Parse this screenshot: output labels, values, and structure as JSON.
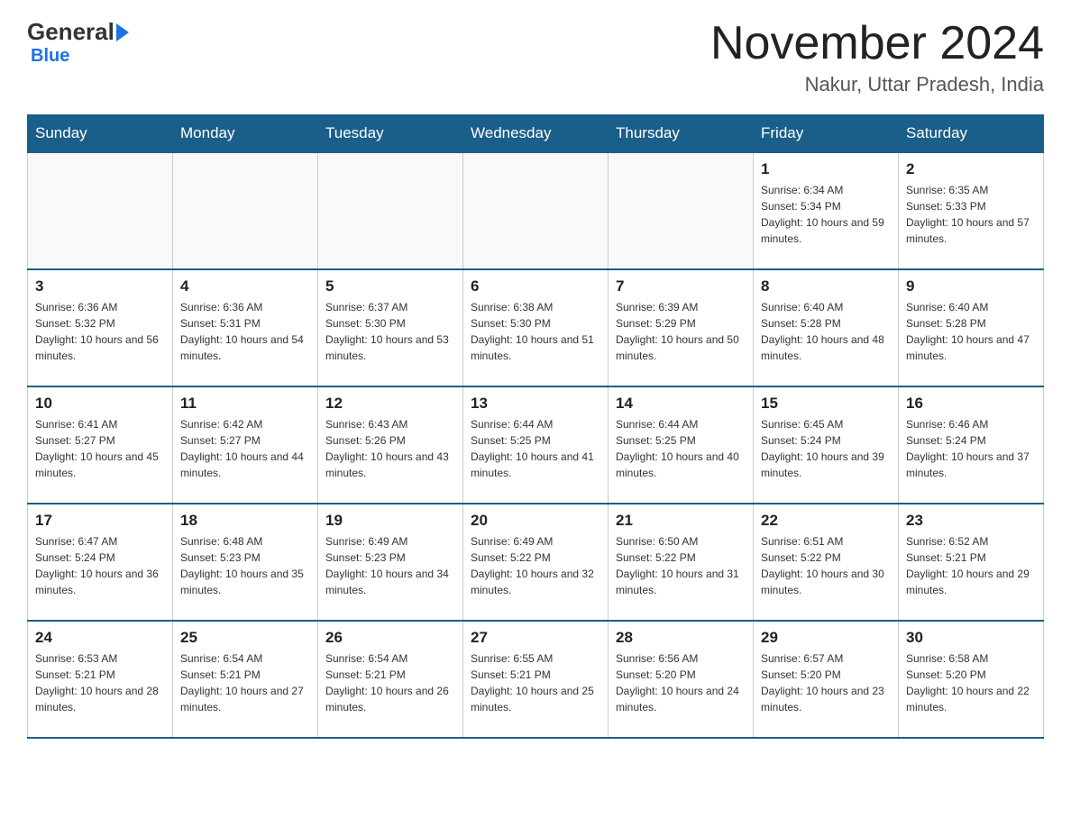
{
  "header": {
    "logo": {
      "general": "General",
      "blue": "Blue"
    },
    "title": "November 2024",
    "location": "Nakur, Uttar Pradesh, India"
  },
  "weekdays": [
    "Sunday",
    "Monday",
    "Tuesday",
    "Wednesday",
    "Thursday",
    "Friday",
    "Saturday"
  ],
  "weeks": [
    [
      {
        "day": "",
        "info": ""
      },
      {
        "day": "",
        "info": ""
      },
      {
        "day": "",
        "info": ""
      },
      {
        "day": "",
        "info": ""
      },
      {
        "day": "",
        "info": ""
      },
      {
        "day": "1",
        "info": "Sunrise: 6:34 AM\nSunset: 5:34 PM\nDaylight: 10 hours and 59 minutes."
      },
      {
        "day": "2",
        "info": "Sunrise: 6:35 AM\nSunset: 5:33 PM\nDaylight: 10 hours and 57 minutes."
      }
    ],
    [
      {
        "day": "3",
        "info": "Sunrise: 6:36 AM\nSunset: 5:32 PM\nDaylight: 10 hours and 56 minutes."
      },
      {
        "day": "4",
        "info": "Sunrise: 6:36 AM\nSunset: 5:31 PM\nDaylight: 10 hours and 54 minutes."
      },
      {
        "day": "5",
        "info": "Sunrise: 6:37 AM\nSunset: 5:30 PM\nDaylight: 10 hours and 53 minutes."
      },
      {
        "day": "6",
        "info": "Sunrise: 6:38 AM\nSunset: 5:30 PM\nDaylight: 10 hours and 51 minutes."
      },
      {
        "day": "7",
        "info": "Sunrise: 6:39 AM\nSunset: 5:29 PM\nDaylight: 10 hours and 50 minutes."
      },
      {
        "day": "8",
        "info": "Sunrise: 6:40 AM\nSunset: 5:28 PM\nDaylight: 10 hours and 48 minutes."
      },
      {
        "day": "9",
        "info": "Sunrise: 6:40 AM\nSunset: 5:28 PM\nDaylight: 10 hours and 47 minutes."
      }
    ],
    [
      {
        "day": "10",
        "info": "Sunrise: 6:41 AM\nSunset: 5:27 PM\nDaylight: 10 hours and 45 minutes."
      },
      {
        "day": "11",
        "info": "Sunrise: 6:42 AM\nSunset: 5:27 PM\nDaylight: 10 hours and 44 minutes."
      },
      {
        "day": "12",
        "info": "Sunrise: 6:43 AM\nSunset: 5:26 PM\nDaylight: 10 hours and 43 minutes."
      },
      {
        "day": "13",
        "info": "Sunrise: 6:44 AM\nSunset: 5:25 PM\nDaylight: 10 hours and 41 minutes."
      },
      {
        "day": "14",
        "info": "Sunrise: 6:44 AM\nSunset: 5:25 PM\nDaylight: 10 hours and 40 minutes."
      },
      {
        "day": "15",
        "info": "Sunrise: 6:45 AM\nSunset: 5:24 PM\nDaylight: 10 hours and 39 minutes."
      },
      {
        "day": "16",
        "info": "Sunrise: 6:46 AM\nSunset: 5:24 PM\nDaylight: 10 hours and 37 minutes."
      }
    ],
    [
      {
        "day": "17",
        "info": "Sunrise: 6:47 AM\nSunset: 5:24 PM\nDaylight: 10 hours and 36 minutes."
      },
      {
        "day": "18",
        "info": "Sunrise: 6:48 AM\nSunset: 5:23 PM\nDaylight: 10 hours and 35 minutes."
      },
      {
        "day": "19",
        "info": "Sunrise: 6:49 AM\nSunset: 5:23 PM\nDaylight: 10 hours and 34 minutes."
      },
      {
        "day": "20",
        "info": "Sunrise: 6:49 AM\nSunset: 5:22 PM\nDaylight: 10 hours and 32 minutes."
      },
      {
        "day": "21",
        "info": "Sunrise: 6:50 AM\nSunset: 5:22 PM\nDaylight: 10 hours and 31 minutes."
      },
      {
        "day": "22",
        "info": "Sunrise: 6:51 AM\nSunset: 5:22 PM\nDaylight: 10 hours and 30 minutes."
      },
      {
        "day": "23",
        "info": "Sunrise: 6:52 AM\nSunset: 5:21 PM\nDaylight: 10 hours and 29 minutes."
      }
    ],
    [
      {
        "day": "24",
        "info": "Sunrise: 6:53 AM\nSunset: 5:21 PM\nDaylight: 10 hours and 28 minutes."
      },
      {
        "day": "25",
        "info": "Sunrise: 6:54 AM\nSunset: 5:21 PM\nDaylight: 10 hours and 27 minutes."
      },
      {
        "day": "26",
        "info": "Sunrise: 6:54 AM\nSunset: 5:21 PM\nDaylight: 10 hours and 26 minutes."
      },
      {
        "day": "27",
        "info": "Sunrise: 6:55 AM\nSunset: 5:21 PM\nDaylight: 10 hours and 25 minutes."
      },
      {
        "day": "28",
        "info": "Sunrise: 6:56 AM\nSunset: 5:20 PM\nDaylight: 10 hours and 24 minutes."
      },
      {
        "day": "29",
        "info": "Sunrise: 6:57 AM\nSunset: 5:20 PM\nDaylight: 10 hours and 23 minutes."
      },
      {
        "day": "30",
        "info": "Sunrise: 6:58 AM\nSunset: 5:20 PM\nDaylight: 10 hours and 22 minutes."
      }
    ]
  ]
}
